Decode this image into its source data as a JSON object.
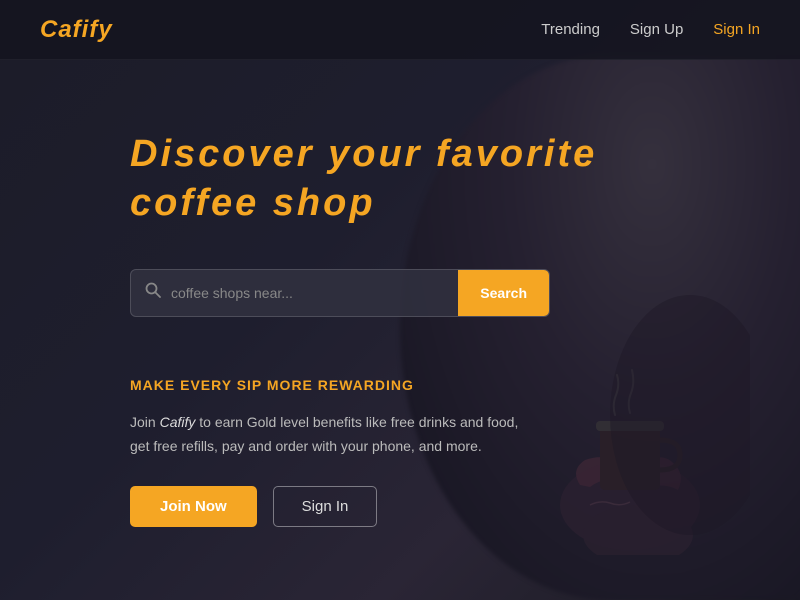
{
  "brand": {
    "logo": "Cafify"
  },
  "navbar": {
    "links": [
      {
        "label": "Trending",
        "id": "trending",
        "highlight": false
      },
      {
        "label": "Sign Up",
        "id": "signup",
        "highlight": false
      },
      {
        "label": "Sign In",
        "id": "signin",
        "highlight": true
      }
    ]
  },
  "hero": {
    "title_line1": "Discover your favorite",
    "title_line2": "coffee shop"
  },
  "search": {
    "placeholder": "coffee shops near...",
    "button_label": "Search",
    "icon": "🔍"
  },
  "cta": {
    "headline": "MAKE EVERY SIP MORE REWARDING",
    "description_prefix": "Join ",
    "brand_name": "Cafify",
    "description_suffix": " to earn Gold level benefits like free drinks and food, get free refills, pay and order with your phone, and more.",
    "join_button": "Join Now",
    "signin_button": "Sign In"
  }
}
